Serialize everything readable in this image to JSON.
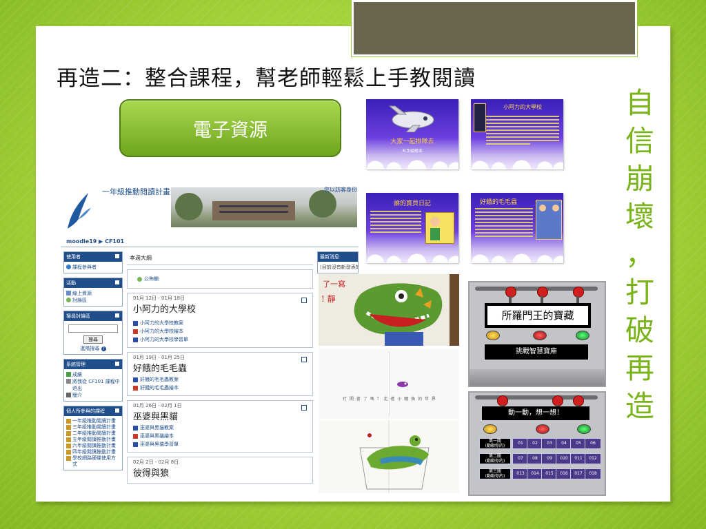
{
  "slide": {
    "title": "再造二：整合課程，幫老師輕鬆上手教閱讀",
    "side_text": [
      "自",
      "信",
      "崩",
      "壞",
      "，",
      "打",
      "破",
      "再",
      "造"
    ],
    "eresource_button": "電子資源"
  },
  "moodle": {
    "header_title": "一年級推動閱讀計畫",
    "header_right": "您以訪客身份",
    "breadcrumb": "moodle19 ▶ CF101",
    "left_blocks": [
      {
        "title": "使用者",
        "items": [
          "課程參與者"
        ]
      },
      {
        "title": "活動",
        "items": [
          "線上資源",
          "討論區"
        ]
      },
      {
        "title": "搜尋討論區",
        "items": [
          "搜尋",
          "進階搜尋"
        ]
      },
      {
        "title": "系統管理",
        "items": [
          "成績",
          "將我從 CF101 課程中退出",
          "簡介"
        ]
      },
      {
        "title": "個人所參與的課程",
        "items": [
          "一年級推動閱讀計畫",
          "三年級推動閱讀計畫",
          "二年級推動閱讀計畫",
          "五年級閱讀推動計畫",
          "六年級閱讀推動計畫",
          "四年級閱讀推動計畫",
          "學校網路硬碟使用方式"
        ]
      }
    ],
    "outline_title": "本週大綱",
    "news": "公佈欄",
    "weeks": [
      {
        "date": "01月 12日 - 01月 18日",
        "title": "小阿力的大學校",
        "resources": [
          "小阿力的大學校教案",
          "小阿力的大學校繪本",
          "小阿力的大學校學習單"
        ]
      },
      {
        "date": "01月 19日 - 01月 25日",
        "title": "好餓的毛毛蟲",
        "resources": [
          "好餓的毛毛蟲教案",
          "好餓的毛毛蟲繪本"
        ]
      },
      {
        "date": "01月 26日 - 02月 1日",
        "title": "巫婆與黑貓",
        "resources": [
          "巫婆與黑貓教案",
          "巫婆與黑貓繪本",
          "巫婆與黑貓學習單"
        ]
      },
      {
        "date": "02月 2日 - 02月 8日",
        "title": "彼得與狼",
        "resources": []
      }
    ],
    "right_block_title": "最新消息",
    "right_block_text": "(目前沒有新發表的"
  },
  "thumbnails": [
    {
      "title": "大家一起排隊去",
      "subtitle": "五年級繪本"
    },
    {
      "title": "小阿力的大學校",
      "subtitle": ""
    },
    {
      "title": "誰的寶貝日記",
      "subtitle": ""
    },
    {
      "title": "好餓的毛毛蟲",
      "subtitle": ""
    }
  ],
  "illustration_text": "打 開 書 了 嗎 ？ 走 進 小 鱷 魚 的 世 界",
  "quiz1": {
    "title": "所羅門王的寶藏",
    "bar": "挑戰智慧寶庫"
  },
  "quiz2": {
    "title": "動一動，想一想！",
    "rows": [
      {
        "label": "第一關\n(動動你的)",
        "cells": [
          "01",
          "02",
          "03",
          "04",
          "05",
          "06"
        ]
      },
      {
        "label": "第二關\n(動動你的)",
        "cells": [
          "07",
          "08",
          "09",
          "010",
          "011",
          "012"
        ]
      },
      {
        "label": "第三關\n(動動你的)",
        "cells": [
          "013",
          "014",
          "015",
          "016",
          "017",
          "018"
        ]
      }
    ]
  },
  "colors": {
    "accent_green": "#7ab41a",
    "button_green": "#8cc63e",
    "moodle_blue": "#1f4e8a",
    "tab_brown": "#6b6650"
  }
}
